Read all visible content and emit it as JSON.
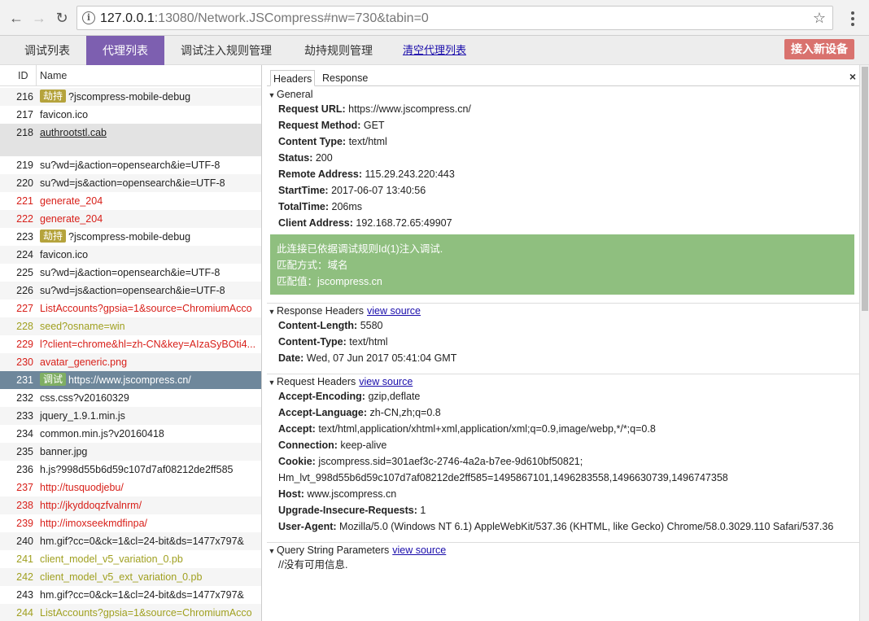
{
  "browser": {
    "url_host": "127.0.0.1",
    "url_rest": ":13080/Network.JSCompress#nw=730&tabin=0"
  },
  "apptabs": [
    {
      "label": "调试列表"
    },
    {
      "label": "代理列表"
    },
    {
      "label": "调试注入规则管理"
    },
    {
      "label": "劫持规则管理"
    },
    {
      "label": "清空代理列表"
    }
  ],
  "new_device_label": "接入新设备",
  "list": {
    "col_id": "ID",
    "col_name": "Name",
    "rows": [
      {
        "id": "216",
        "badge": "劫持",
        "name": "?jscompress-mobile-debug"
      },
      {
        "id": "217",
        "name": "favicon.ico"
      },
      {
        "id": "218",
        "name": "authrootstl.cab"
      },
      {
        "id": "219",
        "name": "su?wd=j&action=opensearch&ie=UTF-8"
      },
      {
        "id": "220",
        "name": "su?wd=js&action=opensearch&ie=UTF-8"
      },
      {
        "id": "221",
        "name": "generate_204"
      },
      {
        "id": "222",
        "name": "generate_204"
      },
      {
        "id": "223",
        "badge": "劫持",
        "name": "?jscompress-mobile-debug"
      },
      {
        "id": "224",
        "name": "favicon.ico"
      },
      {
        "id": "225",
        "name": "su?wd=j&action=opensearch&ie=UTF-8"
      },
      {
        "id": "226",
        "name": "su?wd=js&action=opensearch&ie=UTF-8"
      },
      {
        "id": "227",
        "name": "ListAccounts?gpsia=1&source=ChromiumAcco"
      },
      {
        "id": "228",
        "name": "seed?osname=win"
      },
      {
        "id": "229",
        "name": "l?client=chrome&hl=zh-CN&key=AIzaSyBOti4..."
      },
      {
        "id": "230",
        "name": "avatar_generic.png"
      },
      {
        "id": "231",
        "badge": "调试",
        "name": "https://www.jscompress.cn/"
      },
      {
        "id": "232",
        "name": "css.css?v20160329"
      },
      {
        "id": "233",
        "name": "jquery_1.9.1.min.js"
      },
      {
        "id": "234",
        "name": "common.min.js?v20160418"
      },
      {
        "id": "235",
        "name": "banner.jpg"
      },
      {
        "id": "236",
        "name": "h.js?998d55b6d59c107d7af08212de2ff585"
      },
      {
        "id": "237",
        "name": "http://tusquodjebu/"
      },
      {
        "id": "238",
        "name": "http://jkyddoqzfvalnrm/"
      },
      {
        "id": "239",
        "name": "http://imoxseekmdfinpa/"
      },
      {
        "id": "240",
        "name": "hm.gif?cc=0&ck=1&cl=24-bit&ds=1477x797&"
      },
      {
        "id": "241",
        "name": "client_model_v5_variation_0.pb"
      },
      {
        "id": "242",
        "name": "client_model_v5_ext_variation_0.pb"
      },
      {
        "id": "243",
        "name": "hm.gif?cc=0&ck=1&cl=24-bit&ds=1477x797&"
      },
      {
        "id": "244",
        "name": "ListAccounts?gpsia=1&source=ChromiumAcco"
      }
    ]
  },
  "detail": {
    "tabs": [
      "Headers",
      "Response"
    ],
    "close": "×",
    "general": {
      "title": "General",
      "items": [
        {
          "k": "Request URL:",
          "v": "https://www.jscompress.cn/"
        },
        {
          "k": "Request Method:",
          "v": "GET"
        },
        {
          "k": "Content Type:",
          "v": "text/html"
        },
        {
          "k": "Status:",
          "v": "200"
        },
        {
          "k": "Remote Address:",
          "v": "115.29.243.220:443"
        },
        {
          "k": "StartTime:",
          "v": "2017-06-07 13:40:56"
        },
        {
          "k": "TotalTime:",
          "v": "206ms"
        },
        {
          "k": "Client Address:",
          "v": "192.168.72.65:49907"
        }
      ]
    },
    "notice": {
      "line1": "此连接已依据调试规则Id(1)注入调试.",
      "line2": "匹配方式：域名",
      "line3": "匹配值：jscompress.cn"
    },
    "response_headers": {
      "title": "Response Headers",
      "view_source": "view source",
      "items": [
        {
          "k": "Content-Length:",
          "v": "5580"
        },
        {
          "k": "Content-Type:",
          "v": "text/html"
        },
        {
          "k": "Date:",
          "v": "Wed, 07 Jun 2017 05:41:04 GMT"
        }
      ]
    },
    "request_headers": {
      "title": "Request Headers",
      "view_source": "view source",
      "items": [
        {
          "k": "Accept-Encoding:",
          "v": "gzip,deflate"
        },
        {
          "k": "Accept-Language:",
          "v": "zh-CN,zh;q=0.8"
        },
        {
          "k": "Accept:",
          "v": "text/html,application/xhtml+xml,application/xml;q=0.9,image/webp,*/*;q=0.8"
        },
        {
          "k": "Connection:",
          "v": "keep-alive"
        },
        {
          "k": "Cookie:",
          "v": "jscompress.sid=301aef3c-2746-4a2a-b7ee-9d610bf50821;"
        },
        {
          "k": "",
          "v": "Hm_lvt_998d55b6d59c107d7af08212de2ff585=1495867101,1496283558,1496630739,1496747358"
        },
        {
          "k": "Host:",
          "v": "www.jscompress.cn"
        },
        {
          "k": "Upgrade-Insecure-Requests:",
          "v": "1"
        },
        {
          "k": "User-Agent:",
          "v": "Mozilla/5.0 (Windows NT 6.1) AppleWebKit/537.36 (KHTML, like Gecko) Chrome/58.0.3029.110 Safari/537.36"
        }
      ]
    },
    "query_string": {
      "title": "Query String Parameters",
      "view_source": "view source",
      "empty": "//没有可用信息."
    }
  }
}
